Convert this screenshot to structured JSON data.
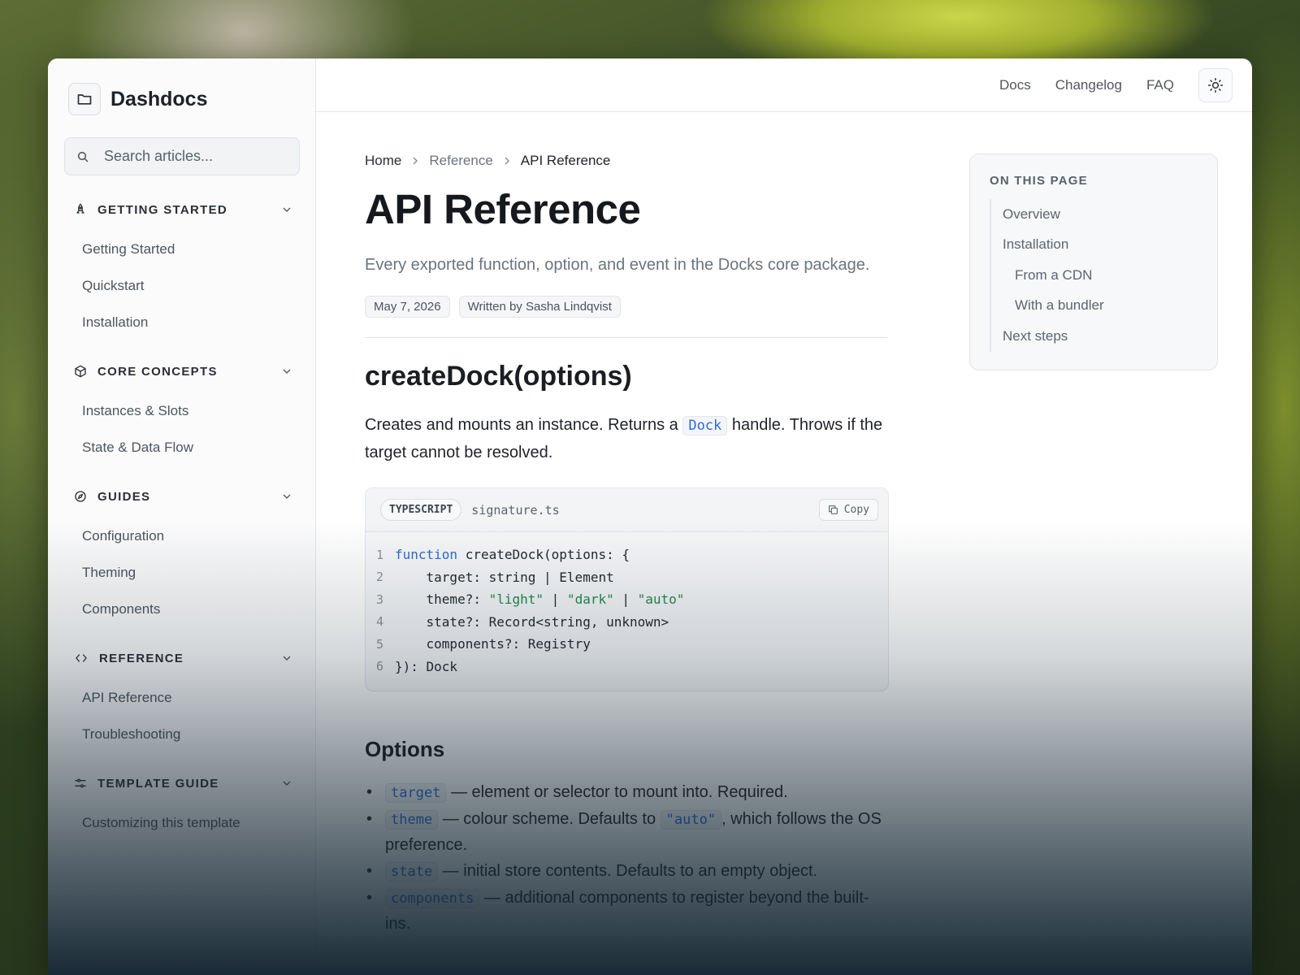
{
  "app": {
    "name": "Dashdocs"
  },
  "search": {
    "placeholder": "Search articles..."
  },
  "topnav": {
    "links": [
      "Docs",
      "Changelog",
      "FAQ"
    ]
  },
  "sidebar": {
    "sections": [
      {
        "title": "GETTING STARTED",
        "icon": "rocket-icon",
        "items": [
          "Getting Started",
          "Quickstart",
          "Installation"
        ]
      },
      {
        "title": "CORE CONCEPTS",
        "icon": "cube-icon",
        "items": [
          "Instances & Slots",
          "State & Data Flow"
        ]
      },
      {
        "title": "GUIDES",
        "icon": "compass-icon",
        "items": [
          "Configuration",
          "Theming",
          "Components"
        ]
      },
      {
        "title": "REFERENCE",
        "icon": "code-brackets-icon",
        "items": [
          "API Reference",
          "Troubleshooting"
        ]
      },
      {
        "title": "TEMPLATE GUIDE",
        "icon": "sliders-icon",
        "items": [
          "Customizing this template"
        ]
      }
    ]
  },
  "breadcrumb": [
    "Home",
    "Reference",
    "API Reference"
  ],
  "page": {
    "title": "API Reference",
    "lede": "Every exported function, option, and event in the Docks core package.",
    "date": "May 7, 2026",
    "author": "Written by Sasha Lindqvist"
  },
  "section": {
    "heading": "createDock(options)",
    "para_before": "Creates and mounts an instance. Returns a ",
    "para_code": "Dock",
    "para_after": " handle. Throws if the target cannot be resolved."
  },
  "code": {
    "language": "TYPESCRIPT",
    "filename": "signature.ts",
    "copy_label": "Copy",
    "lines": [
      [
        {
          "t": "kw",
          "v": "function"
        },
        {
          "t": "plain",
          "v": " createDock(options: {"
        }
      ],
      [
        {
          "t": "plain",
          "v": "    target: string | Element"
        }
      ],
      [
        {
          "t": "plain",
          "v": "    theme?: "
        },
        {
          "t": "str",
          "v": "\"light\""
        },
        {
          "t": "plain",
          "v": " | "
        },
        {
          "t": "str",
          "v": "\"dark\""
        },
        {
          "t": "plain",
          "v": " | "
        },
        {
          "t": "str",
          "v": "\"auto\""
        }
      ],
      [
        {
          "t": "plain",
          "v": "    state?: Record<string, unknown>"
        }
      ],
      [
        {
          "t": "plain",
          "v": "    components?: Registry"
        }
      ],
      [
        {
          "t": "plain",
          "v": "}): Dock"
        }
      ]
    ]
  },
  "options": {
    "heading": "Options",
    "items": [
      {
        "code": "target",
        "text": " — element or selector to mount into. Required."
      },
      {
        "code": "theme",
        "text": " — colour scheme. Defaults to ",
        "code2": "\"auto\"",
        "text2": ", which follows the OS preference."
      },
      {
        "code": "state",
        "text": " — initial store contents. Defaults to an empty object."
      },
      {
        "code": "components",
        "text": " — additional components to register beyond the built-ins."
      }
    ]
  },
  "toc": {
    "title": "ON THIS PAGE",
    "items": [
      {
        "label": "Overview",
        "sub": false
      },
      {
        "label": "Installation",
        "sub": false
      },
      {
        "label": "From a CDN",
        "sub": true
      },
      {
        "label": "With a bundler",
        "sub": true
      },
      {
        "label": "Next steps",
        "sub": false
      }
    ]
  },
  "colors": {
    "accent": "#2f6bd1",
    "string": "#1e8a4c"
  }
}
